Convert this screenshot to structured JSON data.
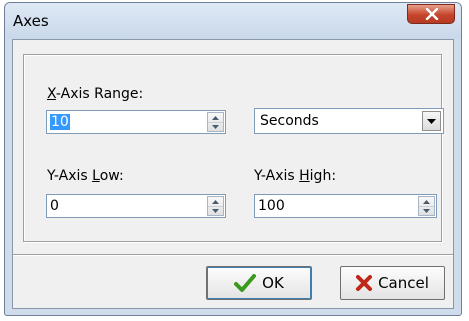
{
  "window": {
    "title": "Axes",
    "close_glyph": "X"
  },
  "form": {
    "x_range_label_hot": "X",
    "x_range_label_rest": "-Axis Range:",
    "x_range_value": "10",
    "unit_value": "Seconds",
    "y_low_label_prefix": "Y-Axis ",
    "y_low_label_hot": "L",
    "y_low_label_rest": "ow:",
    "y_low_value": "0",
    "y_high_label_prefix": "Y-Axis ",
    "y_high_label_hot": "H",
    "y_high_label_rest": "igh:",
    "y_high_value": "100"
  },
  "buttons": {
    "ok_label": "OK",
    "cancel_label": "Cancel"
  },
  "icons": {
    "ok": "checkmark-icon",
    "cancel": "cross-icon",
    "close": "close-icon"
  },
  "colors": {
    "ok_icon": "#3a9a1e",
    "cancel_icon": "#c0261a",
    "close_button": "#c5452c",
    "selection": "#3399ff"
  }
}
